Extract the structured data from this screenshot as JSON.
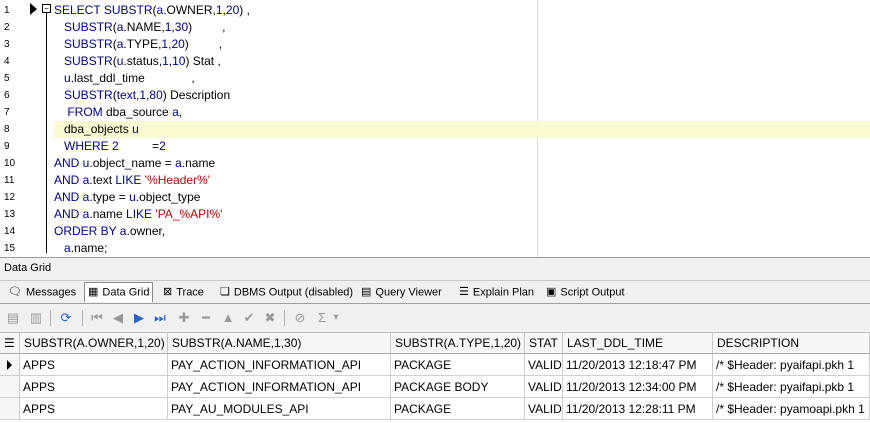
{
  "editor": {
    "line_numbers": [
      "1",
      "2",
      "3",
      "4",
      "5",
      "6",
      "7",
      "8",
      "9",
      "10",
      "11",
      "12",
      "13",
      "14",
      "15"
    ],
    "lines": [
      [
        {
          "t": "SELECT ",
          "c": "kw"
        },
        {
          "t": "SUBSTR",
          "c": "kw"
        },
        {
          "t": "(",
          "c": ""
        },
        {
          "t": "a",
          "c": "kw"
        },
        {
          "t": ".OWNER,",
          "c": ""
        },
        {
          "t": "1",
          "c": "kw"
        },
        {
          "t": ",",
          "c": ""
        },
        {
          "t": "20",
          "c": "kw"
        },
        {
          "t": ") ,",
          "c": ""
        }
      ],
      [
        {
          "t": "   ",
          "c": ""
        },
        {
          "t": "SUBSTR",
          "c": "kw"
        },
        {
          "t": "(",
          "c": ""
        },
        {
          "t": "a",
          "c": "kw"
        },
        {
          "t": ".NAME,",
          "c": ""
        },
        {
          "t": "1",
          "c": "kw"
        },
        {
          "t": ",",
          "c": ""
        },
        {
          "t": "30",
          "c": "kw"
        },
        {
          "t": ")         ,",
          "c": ""
        }
      ],
      [
        {
          "t": "   ",
          "c": ""
        },
        {
          "t": "SUBSTR",
          "c": "kw"
        },
        {
          "t": "(",
          "c": ""
        },
        {
          "t": "a",
          "c": "kw"
        },
        {
          "t": ".TYPE,",
          "c": ""
        },
        {
          "t": "1",
          "c": "kw"
        },
        {
          "t": ",",
          "c": ""
        },
        {
          "t": "20",
          "c": "kw"
        },
        {
          "t": ")         ,",
          "c": ""
        }
      ],
      [
        {
          "t": "   ",
          "c": ""
        },
        {
          "t": "SUBSTR",
          "c": "kw"
        },
        {
          "t": "(",
          "c": ""
        },
        {
          "t": "u",
          "c": "kw"
        },
        {
          "t": ".status,",
          "c": ""
        },
        {
          "t": "1",
          "c": "kw"
        },
        {
          "t": ",",
          "c": ""
        },
        {
          "t": "10",
          "c": "kw"
        },
        {
          "t": ") Stat ,",
          "c": ""
        }
      ],
      [
        {
          "t": "   ",
          "c": ""
        },
        {
          "t": "u",
          "c": "kw"
        },
        {
          "t": ".last_ddl_time              ,",
          "c": ""
        }
      ],
      [
        {
          "t": "   ",
          "c": ""
        },
        {
          "t": "SUBSTR",
          "c": "kw"
        },
        {
          "t": "(",
          "c": ""
        },
        {
          "t": "text",
          "c": "kw"
        },
        {
          "t": ",",
          "c": ""
        },
        {
          "t": "1",
          "c": "kw"
        },
        {
          "t": ",",
          "c": ""
        },
        {
          "t": "80",
          "c": "kw"
        },
        {
          "t": ") Description",
          "c": ""
        }
      ],
      [
        {
          "t": "    ",
          "c": ""
        },
        {
          "t": "FROM",
          "c": "kw"
        },
        {
          "t": " dba_source ",
          "c": ""
        },
        {
          "t": "a",
          "c": "kw"
        },
        {
          "t": ",",
          "c": ""
        }
      ],
      [
        {
          "t": "   dba_objects ",
          "c": ""
        },
        {
          "t": "u",
          "c": "kw"
        }
      ],
      [
        {
          "t": "   ",
          "c": ""
        },
        {
          "t": "WHERE",
          "c": "kw"
        },
        {
          "t": " ",
          "c": ""
        },
        {
          "t": "2",
          "c": "kw"
        },
        {
          "t": "          =",
          "c": ""
        },
        {
          "t": "2",
          "c": "kw"
        }
      ],
      [
        {
          "t": "AND ",
          "c": "kw"
        },
        {
          "t": "u",
          "c": "kw"
        },
        {
          "t": ".object_name = ",
          "c": ""
        },
        {
          "t": "a",
          "c": "kw"
        },
        {
          "t": ".name",
          "c": ""
        }
      ],
      [
        {
          "t": "AND ",
          "c": "kw"
        },
        {
          "t": "a",
          "c": "kw"
        },
        {
          "t": ".text ",
          "c": ""
        },
        {
          "t": "LIKE",
          "c": "kw"
        },
        {
          "t": " ",
          "c": ""
        },
        {
          "t": "'%Header%'",
          "c": "str"
        }
      ],
      [
        {
          "t": "AND ",
          "c": "kw"
        },
        {
          "t": "a",
          "c": "kw"
        },
        {
          "t": ".type = ",
          "c": ""
        },
        {
          "t": "u",
          "c": "kw"
        },
        {
          "t": ".object_type",
          "c": ""
        }
      ],
      [
        {
          "t": "AND ",
          "c": "kw"
        },
        {
          "t": "a",
          "c": "kw"
        },
        {
          "t": ".name ",
          "c": ""
        },
        {
          "t": "LIKE",
          "c": "kw"
        },
        {
          "t": " ",
          "c": ""
        },
        {
          "t": "'PA_%API%'",
          "c": "str"
        }
      ],
      [
        {
          "t": "ORDER BY ",
          "c": "kw"
        },
        {
          "t": "a",
          "c": "kw"
        },
        {
          "t": ".owner,",
          "c": ""
        }
      ],
      [
        {
          "t": "   ",
          "c": ""
        },
        {
          "t": "a",
          "c": "kw"
        },
        {
          "t": ".name;",
          "c": ""
        }
      ]
    ],
    "highlighted_line": 8
  },
  "datagrid_title": "Data Grid",
  "tabs": [
    {
      "label": "Messages",
      "icon": "messages-icon"
    },
    {
      "label": "Data Grid",
      "icon": "grid-icon"
    },
    {
      "label": "Trace",
      "icon": "trace-icon"
    },
    {
      "label": "DBMS Output (disabled)",
      "icon": "dbms-output-icon"
    },
    {
      "label": "Query Viewer",
      "icon": "query-viewer-icon"
    },
    {
      "label": "Explain Plan",
      "icon": "explain-plan-icon"
    },
    {
      "label": "Script Output",
      "icon": "script-output-icon"
    }
  ],
  "toolbar": {
    "sum_symbol": "Σ",
    "dropdown_symbol": "▾"
  },
  "grid": {
    "columns": [
      "SUBSTR(A.OWNER,1,20)",
      "SUBSTR(A.NAME,1,30)",
      "SUBSTR(A.TYPE,1,20)",
      "STAT",
      "LAST_DDL_TIME",
      "DESCRIPTION"
    ],
    "rows": [
      [
        "APPS",
        "PAY_ACTION_INFORMATION_API",
        "PACKAGE",
        "VALID",
        "11/20/2013 12:18:47 PM",
        "/* $Header: pyaifapi.pkh 1"
      ],
      [
        "APPS",
        "PAY_ACTION_INFORMATION_API",
        "PACKAGE BODY",
        "VALID",
        "11/20/2013 12:34:00 PM",
        "/* $Header: pyaifapi.pkb 1"
      ],
      [
        "APPS",
        "PAY_AU_MODULES_API",
        "PACKAGE",
        "VALID",
        "11/20/2013 12:28:11 PM",
        "/* $Header: pyamoapi.pkh 1"
      ]
    ]
  }
}
